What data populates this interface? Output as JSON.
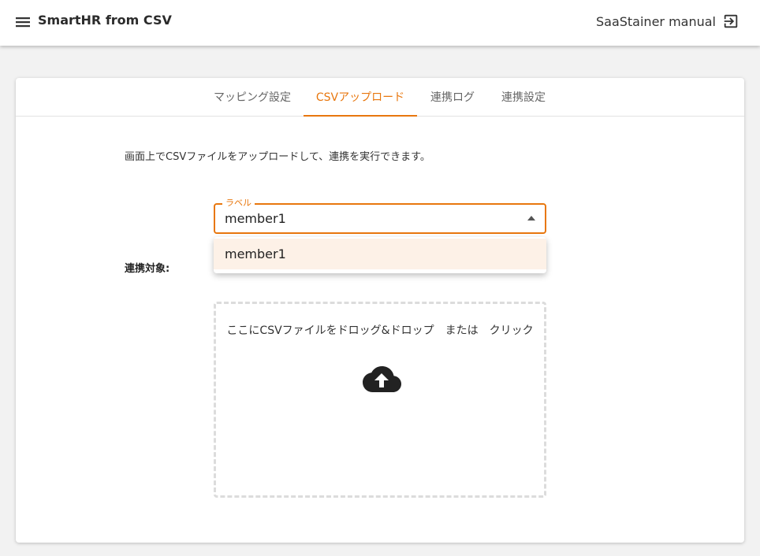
{
  "header": {
    "title": "SmartHR from CSV",
    "manual_label": "SaaStainer manual",
    "icons": {
      "menu": "menu-icon",
      "manual": "exit-to-app-icon"
    }
  },
  "tabs": [
    {
      "label": "マッピング設定",
      "active": false
    },
    {
      "label": "CSVアップロード",
      "active": true
    },
    {
      "label": "連携ログ",
      "active": false
    },
    {
      "label": "連携設定",
      "active": false
    }
  ],
  "main": {
    "description": "画面上でCSVファイルをアップロードして、連携を実行できます。",
    "target_label": "連携対象:",
    "select": {
      "label": "ラベル",
      "value": "member1",
      "options": [
        "member1"
      ]
    },
    "dropzone": {
      "text": "ここにCSVファイルをドロッグ&ドロップ　または　クリック",
      "icon": "cloud-upload-icon"
    }
  },
  "colors": {
    "accent": "#e8770e",
    "background": "#f2f2f2",
    "option_highlight": "#fdf1e7"
  }
}
